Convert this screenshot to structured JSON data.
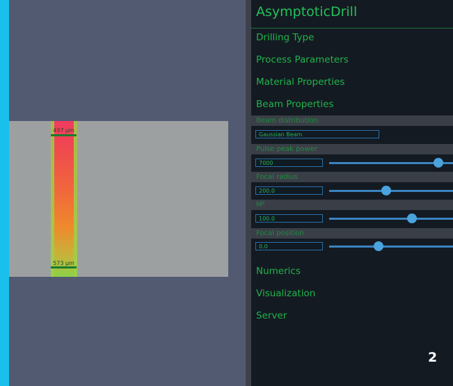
{
  "viewport": {
    "top_measurement": "497 µm",
    "bottom_measurement": "573 µm"
  },
  "panel": {
    "title": "AsymptoticDrill",
    "sections": {
      "drilling_type": "Drilling Type",
      "process_parameters": "Process Parameters",
      "material_properties": "Material Properties",
      "beam_properties": "Beam Properties",
      "numerics": "Numerics",
      "visualization": "Visualization",
      "server": "Server"
    },
    "beam": {
      "distribution": {
        "label": "Beam distribution",
        "value": "Gaussian Beam"
      },
      "pulse_peak_power": {
        "label": "Pulse peak power",
        "value": "7000",
        "slider_fraction": 0.88
      },
      "focal_radius": {
        "label": "Focal radius",
        "value": "200.0",
        "slider_fraction": 0.46
      },
      "m2": {
        "label": "M²",
        "value": "100.0",
        "slider_fraction": 0.67
      },
      "focal_position": {
        "label": "Focal position",
        "value": "0.0",
        "slider_fraction": 0.4
      }
    }
  },
  "page_number": "2",
  "colors": {
    "accent_bar": "#1ac0ec",
    "panel_text": "#1fb44a",
    "slider": "#4aa3dd"
  }
}
